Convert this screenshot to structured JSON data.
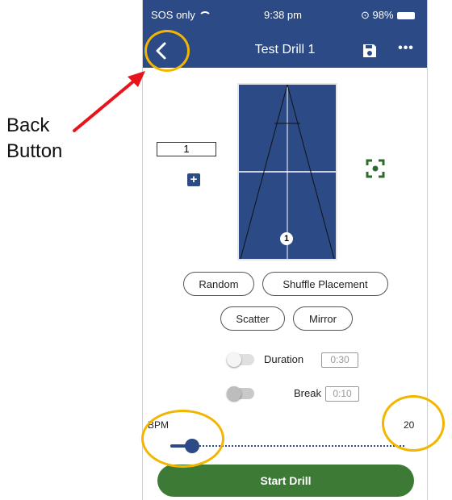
{
  "status_bar": {
    "carrier": "SOS only",
    "time": "9:38 pm",
    "battery": "98%"
  },
  "nav": {
    "title": "Test Drill 1",
    "back_icon": "chevron-left-icon",
    "save_icon": "floppy-disk-icon",
    "more_label": "•••"
  },
  "drill": {
    "count_value": "1",
    "plus_label": "+",
    "court_marker": "1"
  },
  "options": {
    "random": "Random",
    "shuffle": "Shuffle Placement",
    "scatter": "Scatter",
    "mirror": "Mirror"
  },
  "timers": {
    "duration_label": "Duration",
    "duration_value": "0:30",
    "break_label": "Break",
    "break_value": "0:10"
  },
  "bpm": {
    "label": "BPM",
    "value": "20"
  },
  "start_button": "Start Drill",
  "annotation": {
    "line1": "Back",
    "line2": "Button"
  },
  "colors": {
    "primary": "#2b4a86",
    "start_green": "#3d7a36",
    "focus_green": "#2f6b2f",
    "annotation_yellow": "#f2b600",
    "arrow_red": "#e8141c"
  }
}
